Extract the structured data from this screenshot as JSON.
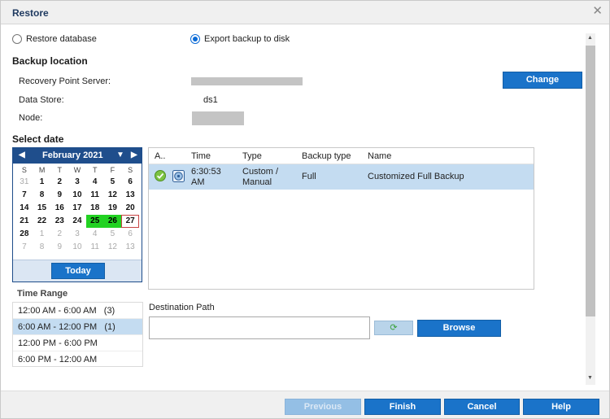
{
  "dialog": {
    "title": "Restore"
  },
  "options": {
    "restore_database": "Restore database",
    "export_backup": "Export backup to disk",
    "selected": "export_backup"
  },
  "backup_location": {
    "title": "Backup location",
    "rps_label": "Recovery Point Server:",
    "datastore_label": "Data Store:",
    "datastore_value": "ds1",
    "node_label": "Node:",
    "change_button": "Change"
  },
  "select_date": {
    "title": "Select date",
    "month": "February 2021",
    "weekdays": [
      "S",
      "M",
      "T",
      "W",
      "T",
      "F",
      "S"
    ],
    "weeks": [
      [
        "31",
        "1",
        "2",
        "3",
        "4",
        "5",
        "6"
      ],
      [
        "7",
        "8",
        "9",
        "10",
        "11",
        "12",
        "13"
      ],
      [
        "14",
        "15",
        "16",
        "17",
        "18",
        "19",
        "20"
      ],
      [
        "21",
        "22",
        "23",
        "24",
        "25",
        "26",
        "27"
      ],
      [
        "28",
        "1",
        "2",
        "3",
        "4",
        "5",
        "6"
      ],
      [
        "7",
        "8",
        "9",
        "10",
        "11",
        "12",
        "13"
      ]
    ],
    "today_button": "Today"
  },
  "backups_table": {
    "headers": {
      "status": "A..",
      "time": "Time",
      "type": "Type",
      "backup_type": "Backup type",
      "name": "Name"
    },
    "row": {
      "time_line1": "6:30:53",
      "time_line2": "AM",
      "type_line1": "Custom /",
      "type_line2": "Manual",
      "backup_type": "Full",
      "name": "Customized Full Backup"
    }
  },
  "time_range": {
    "title": "Time Range",
    "items": [
      {
        "label": "12:00 AM - 6:00 AM   (3)"
      },
      {
        "label": "6:00 AM - 12:00 PM   (1)"
      },
      {
        "label": "12:00 PM - 6:00 PM"
      },
      {
        "label": "6:00 PM - 12:00 AM"
      }
    ]
  },
  "destination": {
    "label": "Destination Path",
    "value": "",
    "browse_button": "Browse"
  },
  "footer": {
    "previous": "Previous",
    "finish": "Finish",
    "cancel": "Cancel",
    "help": "Help"
  },
  "colors": {
    "accent": "#1a73c9",
    "header_navy": "#1f4e8c",
    "highlight_green": "#22d222",
    "selection": "#c4dcf1"
  }
}
